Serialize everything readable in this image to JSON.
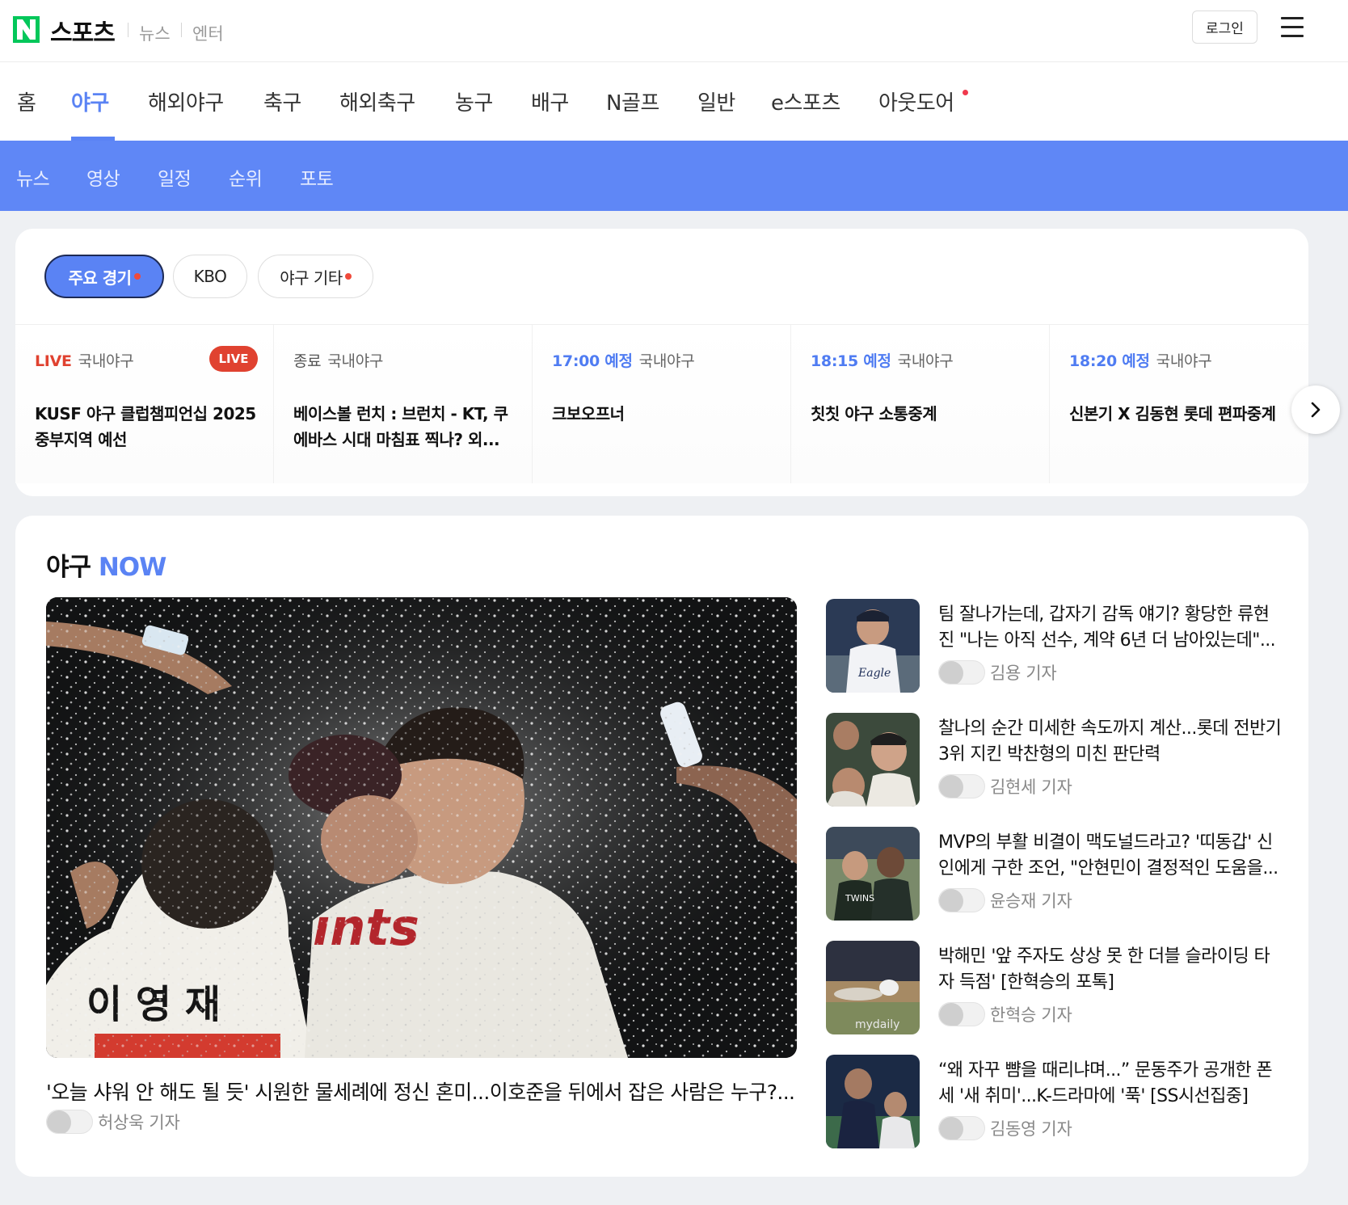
{
  "header": {
    "logo_letter": "N",
    "brand": "스포츠",
    "links": [
      "뉴스",
      "엔터"
    ],
    "login_label": "로그인"
  },
  "gnb": {
    "items": [
      "홈",
      "야구",
      "해외야구",
      "축구",
      "해외축구",
      "농구",
      "배구",
      "N골프",
      "일반",
      "e스포츠",
      "아웃도어"
    ],
    "active": "야구",
    "accent": "#5a83f4"
  },
  "subnav": {
    "items": [
      "뉴스",
      "영상",
      "일정",
      "순위",
      "포토"
    ],
    "background": "#5f87f6"
  },
  "filters": {
    "chips": [
      "주요 경기",
      "KBO",
      "야구 기타"
    ]
  },
  "games": [
    {
      "status": "LIVE",
      "league": "국내야구",
      "badge": "LIVE",
      "title": "KUSF 야구 클럽챔피언십 2025 중부지역 예선",
      "status_color": "#e04230"
    },
    {
      "status": "종료",
      "league": "국내야구",
      "title": "베이스볼 런치 : 브런치 - KT, 쿠에바스 시대 마침표 찍나? 외...",
      "status_color": "#555555"
    },
    {
      "status": "17:00 예정",
      "league": "국내야구",
      "title": "크보오프너",
      "status_color": "#4f7cf2"
    },
    {
      "status": "18:15 예정",
      "league": "국내야구",
      "title": "칫칫 야구 소통중계",
      "status_color": "#4f7cf2"
    },
    {
      "status": "18:20 예정",
      "league": "국내야구",
      "title": "신본기 X 김동현 롯데 편파중계",
      "status_color": "#4f7cf2"
    }
  ],
  "now_section": {
    "title_prefix": "야구",
    "title_suffix": "NOW",
    "main": {
      "title": "'오늘 샤워 안 해도 될 듯' 시원한 물세례에 정신 혼미...이호준을 뒤에서 잡은 사람은 누구?...",
      "reporter": "허상욱 기자",
      "jersey_name": "이 영 재"
    },
    "side_articles": [
      {
        "title": "팀 잘나가는데, 갑자기 감독 얘기? 황당한 류현진 \"나는 아직 선수, 계약 6년 더 남아있는데\"...",
        "reporter": "김용 기자"
      },
      {
        "title": "찰나의 순간 미세한 속도까지 계산...롯데 전반기 3위 지킨 박찬형의 미친 판단력",
        "reporter": "김현세 기자"
      },
      {
        "title": "MVP의 부활 비결이 맥도널드라고? '띠동갑' 신인에게 구한 조언, \"안현민이 결정적인 도움을...",
        "reporter": "윤승재 기자"
      },
      {
        "title": "박해민 '앞 주자도 상상 못 한 더블 슬라이딩 타자 득점' [한혁승의 포톡]",
        "reporter": "한혁승 기자"
      },
      {
        "title": "“왜 자꾸 뺨을 때리냐며...” 문동주가 공개한 폰세 '새 취미'...K-드라마에 '푹' [SS시선집중]",
        "reporter": "김동영 기자"
      }
    ]
  }
}
